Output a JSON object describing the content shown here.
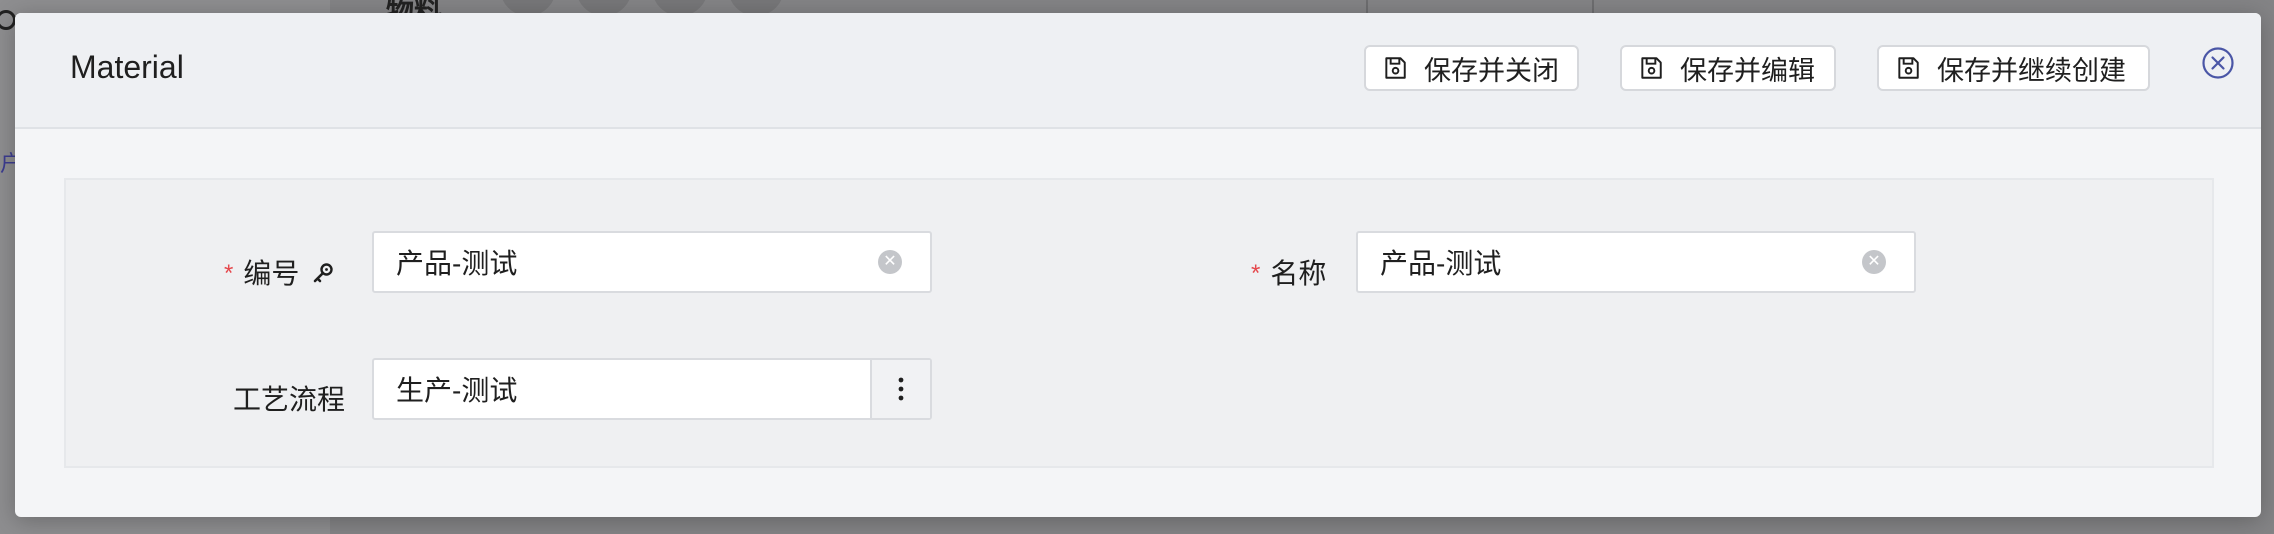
{
  "background": {
    "left_glyph": "户",
    "title_fragment": "物料"
  },
  "modal": {
    "title": "Material",
    "buttons": {
      "save_close": "保存并关闭",
      "save_edit": "保存并编辑",
      "save_continue": "保存并继续创建"
    },
    "close_icon": "close-circle-icon"
  },
  "form": {
    "code": {
      "label": "编号",
      "required": true,
      "required_mark": "*",
      "key_icon": "key-icon",
      "value": "产品-测试"
    },
    "name": {
      "label": "名称",
      "required": true,
      "required_mark": "*",
      "value": "产品-测试"
    },
    "process": {
      "label": "工艺流程",
      "value": "生产-测试",
      "more_icon": "vertical-ellipsis-icon"
    }
  },
  "colors": {
    "required": "#e5484d",
    "close_icon": "#4a56a6",
    "header_bg": "#eef0f3",
    "panel_bg": "#eff0f2"
  }
}
